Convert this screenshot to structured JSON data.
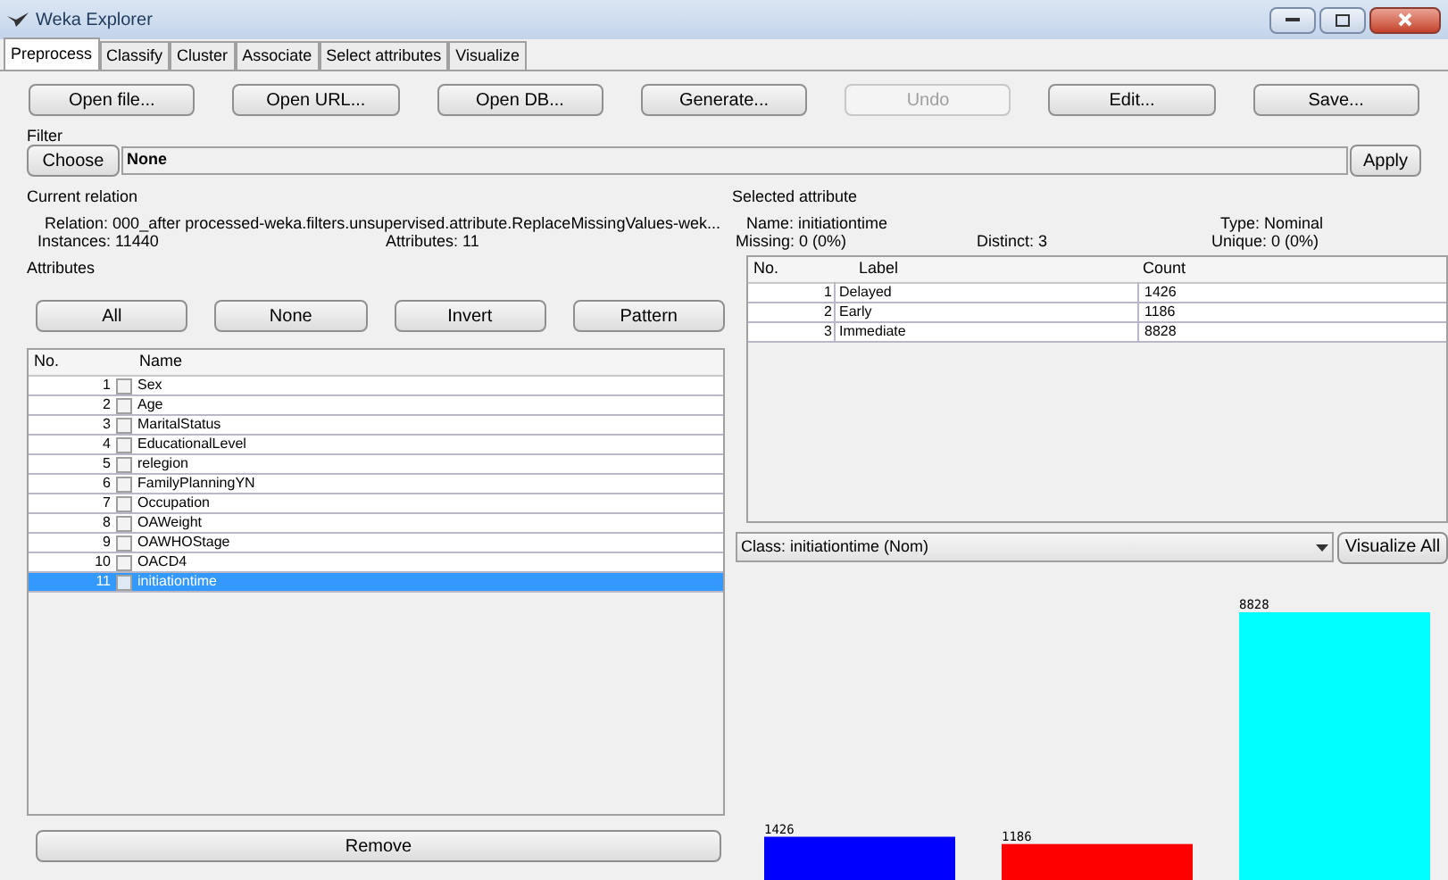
{
  "window": {
    "title": "Weka Explorer"
  },
  "tabs": [
    {
      "label": "Preprocess",
      "selected": true
    },
    {
      "label": "Classify",
      "selected": false
    },
    {
      "label": "Cluster",
      "selected": false
    },
    {
      "label": "Associate",
      "selected": false
    },
    {
      "label": "Select attributes",
      "selected": false
    },
    {
      "label": "Visualize",
      "selected": false
    }
  ],
  "toolbar": [
    {
      "label": "Open file...",
      "disabled": false
    },
    {
      "label": "Open URL...",
      "disabled": false
    },
    {
      "label": "Open DB...",
      "disabled": false
    },
    {
      "label": "Generate...",
      "disabled": false
    },
    {
      "label": "Undo",
      "disabled": true
    },
    {
      "label": "Edit...",
      "disabled": false
    },
    {
      "label": "Save...",
      "disabled": false
    }
  ],
  "filter": {
    "heading": "Filter",
    "choose_button": "Choose",
    "value": "None",
    "apply_button": "Apply"
  },
  "current_relation": {
    "heading": "Current relation",
    "relation_label": "Relation:",
    "relation": "000_after processed-weka.filters.unsupervised.attribute.ReplaceMissingValues-wek...",
    "instances_label": "Instances:",
    "instances": "11440",
    "attributes_label": "Attributes:",
    "attributes": "11"
  },
  "attributes": {
    "heading": "Attributes",
    "buttons": [
      "All",
      "None",
      "Invert",
      "Pattern"
    ],
    "columns": [
      "No.",
      "Name"
    ],
    "rows": [
      {
        "no": "1",
        "name": "Sex",
        "checked": false,
        "selected": false
      },
      {
        "no": "2",
        "name": "Age",
        "checked": false,
        "selected": false
      },
      {
        "no": "3",
        "name": "MaritalStatus",
        "checked": false,
        "selected": false
      },
      {
        "no": "4",
        "name": "EducationalLevel",
        "checked": false,
        "selected": false
      },
      {
        "no": "5",
        "name": "relegion",
        "checked": false,
        "selected": false
      },
      {
        "no": "6",
        "name": "FamilyPlanningYN",
        "checked": false,
        "selected": false
      },
      {
        "no": "7",
        "name": "Occupation",
        "checked": false,
        "selected": false
      },
      {
        "no": "8",
        "name": "OAWeight",
        "checked": false,
        "selected": false
      },
      {
        "no": "9",
        "name": "OAWHOStage",
        "checked": false,
        "selected": false
      },
      {
        "no": "10",
        "name": "OACD4",
        "checked": false,
        "selected": false
      },
      {
        "no": "11",
        "name": "initiationtime",
        "checked": false,
        "selected": true
      }
    ],
    "remove_button": "Remove"
  },
  "selected_attribute": {
    "heading": "Selected attribute",
    "name_label": "Name:",
    "name": "initiationtime",
    "type_label": "Type:",
    "type": "Nominal",
    "missing_label": "Missing:",
    "missing": "0 (0%)",
    "distinct_label": "Distinct:",
    "distinct": "3",
    "unique_label": "Unique:",
    "unique": "0 (0%)",
    "columns": [
      "No.",
      "Label",
      "Count"
    ],
    "rows": [
      {
        "no": "1",
        "label": "Delayed",
        "count": "1426"
      },
      {
        "no": "2",
        "label": "Early",
        "count": "1186"
      },
      {
        "no": "3",
        "label": "Immediate",
        "count": "8828"
      }
    ]
  },
  "class_selector": {
    "value": "Class: initiationtime (Nom)",
    "visualize_button": "Visualize All"
  },
  "chart_data": {
    "type": "bar",
    "values": [
      1426,
      1186,
      8828
    ],
    "colors": [
      "#0000ff",
      "#ff0000",
      "#00ffff"
    ],
    "value_labels": [
      "1426",
      "1186",
      "8828"
    ]
  }
}
